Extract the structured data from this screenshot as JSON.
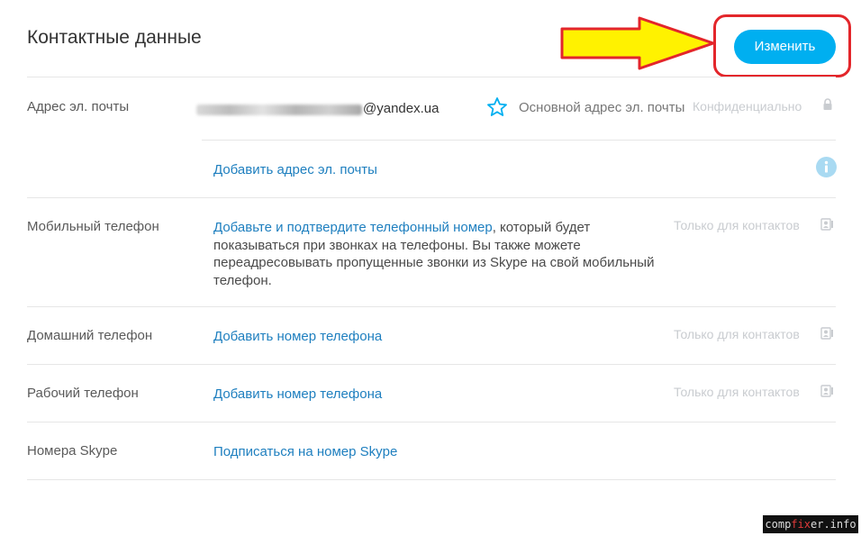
{
  "page": {
    "title": "Контактные данные"
  },
  "header": {
    "edit_button": "Изменить"
  },
  "email": {
    "label": "Адрес эл. почты",
    "value_suffix": "@yandex.ua",
    "primary_text": "Основной адрес эл. почты",
    "privacy": "Конфиденциально",
    "add_link": "Добавить адрес эл. почты"
  },
  "mobile": {
    "label": "Мобильный телефон",
    "link": "Добавьте и подтвердите телефонный номер",
    "rest_line1": ", который будет",
    "line2": "показываться при звонках на телефоны. Вы также можете",
    "line3": "переадресовывать пропущенные звонки из Skype на свой мобильный",
    "line4": "телефон.",
    "privacy": "Только для контактов"
  },
  "home": {
    "label": "Домашний телефон",
    "link": "Добавить номер телефона",
    "privacy": "Только для контактов"
  },
  "work": {
    "label": "Рабочий телефон",
    "link": "Добавить номер телефона",
    "privacy": "Только для контактов"
  },
  "skype": {
    "label": "Номера Skype",
    "link": "Подписаться на номер Skype"
  },
  "watermark": {
    "pre": "comp",
    "x": "fix",
    "post": "er.info"
  },
  "colors": {
    "accent": "#00aff0",
    "link": "#1e7fbf",
    "annotation": "#e3262b",
    "arrow": "#fff200"
  }
}
